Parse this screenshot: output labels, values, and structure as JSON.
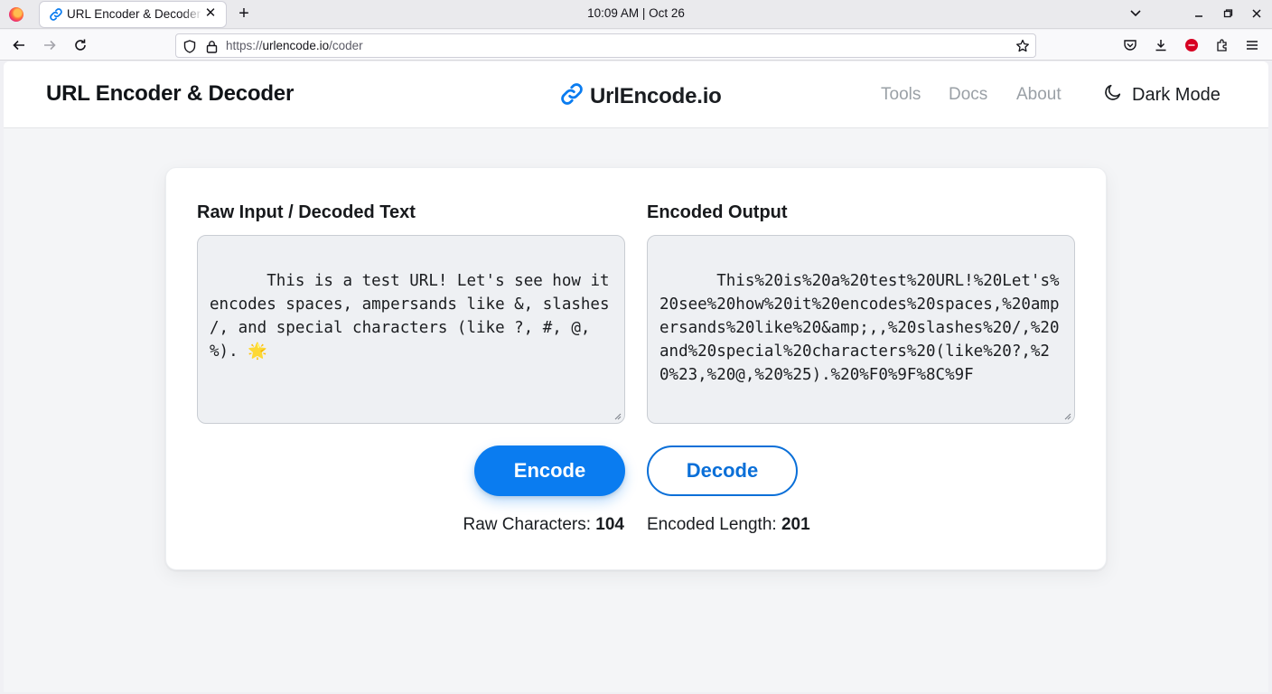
{
  "browser": {
    "tab_title": "URL Encoder & Decoder",
    "clock": "10:09 AM | Oct 26",
    "url_scheme": "https://",
    "url_host": "urlencode.io",
    "url_path": "/coder"
  },
  "header": {
    "site_title": "URL Encoder & Decoder",
    "brand_name": "UrlEncode.io",
    "nav": [
      "Tools",
      "Docs",
      "About"
    ],
    "dark_mode_label": "Dark Mode"
  },
  "coder": {
    "input_label": "Raw Input / Decoded Text",
    "input_value": "This is a test URL! Let's see how it encodes spaces, ampersands like &, slashes /, and special characters (like ?, #, @, %). 🌟",
    "output_label": "Encoded Output",
    "output_value": "This%20is%20a%20test%20URL!%20Let's%20see%20how%20it%20encodes%20spaces,%20ampersands%20like%20&amp;,,%20slashes%20/,%20and%20special%20characters%20(like%20?,%20%23,%20@,%20%25).%20%F0%9F%8C%9F",
    "encode_label": "Encode",
    "decode_label": "Decode",
    "raw_chars_label": "Raw Characters:",
    "raw_chars_value": "104",
    "encoded_len_label": "Encoded Length:",
    "encoded_len_value": "201"
  },
  "colors": {
    "accent": "#0a7cf0",
    "decode_border": "#0a6fd8"
  }
}
